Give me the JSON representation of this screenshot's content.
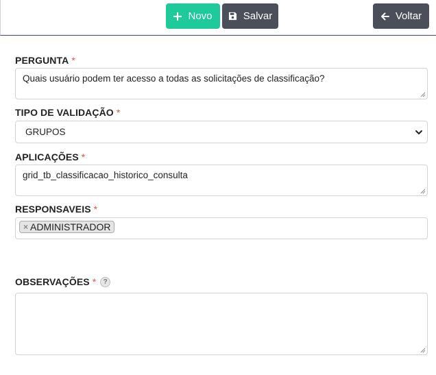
{
  "toolbar": {
    "novo_label": "Novo",
    "salvar_label": "Salvar",
    "voltar_label": "Voltar"
  },
  "form": {
    "pergunta": {
      "label": "PERGUNTA",
      "required_mark": "*",
      "value": "Quais usuário podem ter acesso a todas as solicitações de classificação?"
    },
    "tipo_validacao": {
      "label": "TIPO DE VALIDAÇÃO",
      "required_mark": "*",
      "selected": "GRUPOS"
    },
    "aplicacoes": {
      "label": "APLICAÇÕES",
      "required_mark": "*",
      "value": "grid_tb_classificacao_historico_consulta"
    },
    "responsaveis": {
      "label": "RESPONSAVEIS",
      "required_mark": "*",
      "tags": [
        "ADMINISTRADOR"
      ],
      "remove_symbol": "×"
    },
    "observacoes": {
      "label": "OBSERVAÇÕES",
      "required_mark": "*",
      "help_symbol": "?",
      "value": ""
    }
  },
  "colors": {
    "novo": "#1ec99a",
    "dark_button": "#4a4f59",
    "required": "#d9534f",
    "toolbar_border": "#3a3f8f"
  }
}
